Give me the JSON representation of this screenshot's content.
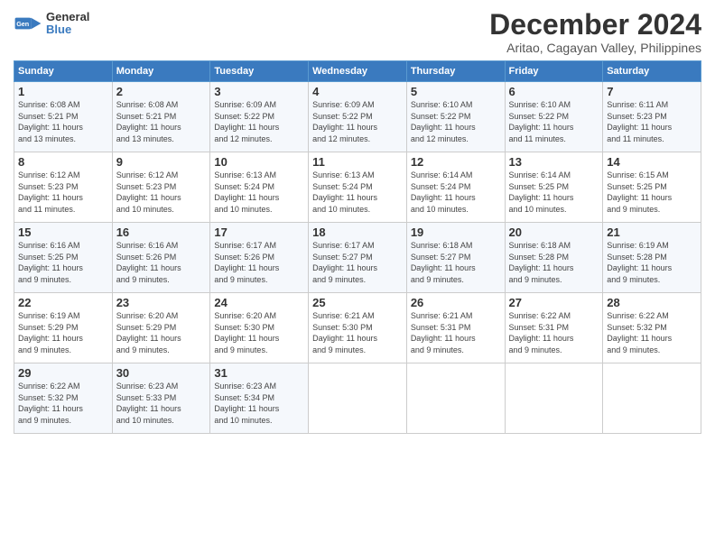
{
  "logo": {
    "line1": "General",
    "line2": "Blue"
  },
  "title": "December 2024",
  "subtitle": "Aritao, Cagayan Valley, Philippines",
  "days_of_week": [
    "Sunday",
    "Monday",
    "Tuesday",
    "Wednesday",
    "Thursday",
    "Friday",
    "Saturday"
  ],
  "weeks": [
    [
      {
        "day": "1",
        "info": "Sunrise: 6:08 AM\nSunset: 5:21 PM\nDaylight: 11 hours\nand 13 minutes."
      },
      {
        "day": "2",
        "info": "Sunrise: 6:08 AM\nSunset: 5:21 PM\nDaylight: 11 hours\nand 13 minutes."
      },
      {
        "day": "3",
        "info": "Sunrise: 6:09 AM\nSunset: 5:22 PM\nDaylight: 11 hours\nand 12 minutes."
      },
      {
        "day": "4",
        "info": "Sunrise: 6:09 AM\nSunset: 5:22 PM\nDaylight: 11 hours\nand 12 minutes."
      },
      {
        "day": "5",
        "info": "Sunrise: 6:10 AM\nSunset: 5:22 PM\nDaylight: 11 hours\nand 12 minutes."
      },
      {
        "day": "6",
        "info": "Sunrise: 6:10 AM\nSunset: 5:22 PM\nDaylight: 11 hours\nand 11 minutes."
      },
      {
        "day": "7",
        "info": "Sunrise: 6:11 AM\nSunset: 5:23 PM\nDaylight: 11 hours\nand 11 minutes."
      }
    ],
    [
      {
        "day": "8",
        "info": "Sunrise: 6:12 AM\nSunset: 5:23 PM\nDaylight: 11 hours\nand 11 minutes."
      },
      {
        "day": "9",
        "info": "Sunrise: 6:12 AM\nSunset: 5:23 PM\nDaylight: 11 hours\nand 10 minutes."
      },
      {
        "day": "10",
        "info": "Sunrise: 6:13 AM\nSunset: 5:24 PM\nDaylight: 11 hours\nand 10 minutes."
      },
      {
        "day": "11",
        "info": "Sunrise: 6:13 AM\nSunset: 5:24 PM\nDaylight: 11 hours\nand 10 minutes."
      },
      {
        "day": "12",
        "info": "Sunrise: 6:14 AM\nSunset: 5:24 PM\nDaylight: 11 hours\nand 10 minutes."
      },
      {
        "day": "13",
        "info": "Sunrise: 6:14 AM\nSunset: 5:25 PM\nDaylight: 11 hours\nand 10 minutes."
      },
      {
        "day": "14",
        "info": "Sunrise: 6:15 AM\nSunset: 5:25 PM\nDaylight: 11 hours\nand 9 minutes."
      }
    ],
    [
      {
        "day": "15",
        "info": "Sunrise: 6:16 AM\nSunset: 5:25 PM\nDaylight: 11 hours\nand 9 minutes."
      },
      {
        "day": "16",
        "info": "Sunrise: 6:16 AM\nSunset: 5:26 PM\nDaylight: 11 hours\nand 9 minutes."
      },
      {
        "day": "17",
        "info": "Sunrise: 6:17 AM\nSunset: 5:26 PM\nDaylight: 11 hours\nand 9 minutes."
      },
      {
        "day": "18",
        "info": "Sunrise: 6:17 AM\nSunset: 5:27 PM\nDaylight: 11 hours\nand 9 minutes."
      },
      {
        "day": "19",
        "info": "Sunrise: 6:18 AM\nSunset: 5:27 PM\nDaylight: 11 hours\nand 9 minutes."
      },
      {
        "day": "20",
        "info": "Sunrise: 6:18 AM\nSunset: 5:28 PM\nDaylight: 11 hours\nand 9 minutes."
      },
      {
        "day": "21",
        "info": "Sunrise: 6:19 AM\nSunset: 5:28 PM\nDaylight: 11 hours\nand 9 minutes."
      }
    ],
    [
      {
        "day": "22",
        "info": "Sunrise: 6:19 AM\nSunset: 5:29 PM\nDaylight: 11 hours\nand 9 minutes."
      },
      {
        "day": "23",
        "info": "Sunrise: 6:20 AM\nSunset: 5:29 PM\nDaylight: 11 hours\nand 9 minutes."
      },
      {
        "day": "24",
        "info": "Sunrise: 6:20 AM\nSunset: 5:30 PM\nDaylight: 11 hours\nand 9 minutes."
      },
      {
        "day": "25",
        "info": "Sunrise: 6:21 AM\nSunset: 5:30 PM\nDaylight: 11 hours\nand 9 minutes."
      },
      {
        "day": "26",
        "info": "Sunrise: 6:21 AM\nSunset: 5:31 PM\nDaylight: 11 hours\nand 9 minutes."
      },
      {
        "day": "27",
        "info": "Sunrise: 6:22 AM\nSunset: 5:31 PM\nDaylight: 11 hours\nand 9 minutes."
      },
      {
        "day": "28",
        "info": "Sunrise: 6:22 AM\nSunset: 5:32 PM\nDaylight: 11 hours\nand 9 minutes."
      }
    ],
    [
      {
        "day": "29",
        "info": "Sunrise: 6:22 AM\nSunset: 5:32 PM\nDaylight: 11 hours\nand 9 minutes."
      },
      {
        "day": "30",
        "info": "Sunrise: 6:23 AM\nSunset: 5:33 PM\nDaylight: 11 hours\nand 10 minutes."
      },
      {
        "day": "31",
        "info": "Sunrise: 6:23 AM\nSunset: 5:34 PM\nDaylight: 11 hours\nand 10 minutes."
      },
      {
        "day": "",
        "info": ""
      },
      {
        "day": "",
        "info": ""
      },
      {
        "day": "",
        "info": ""
      },
      {
        "day": "",
        "info": ""
      }
    ]
  ]
}
